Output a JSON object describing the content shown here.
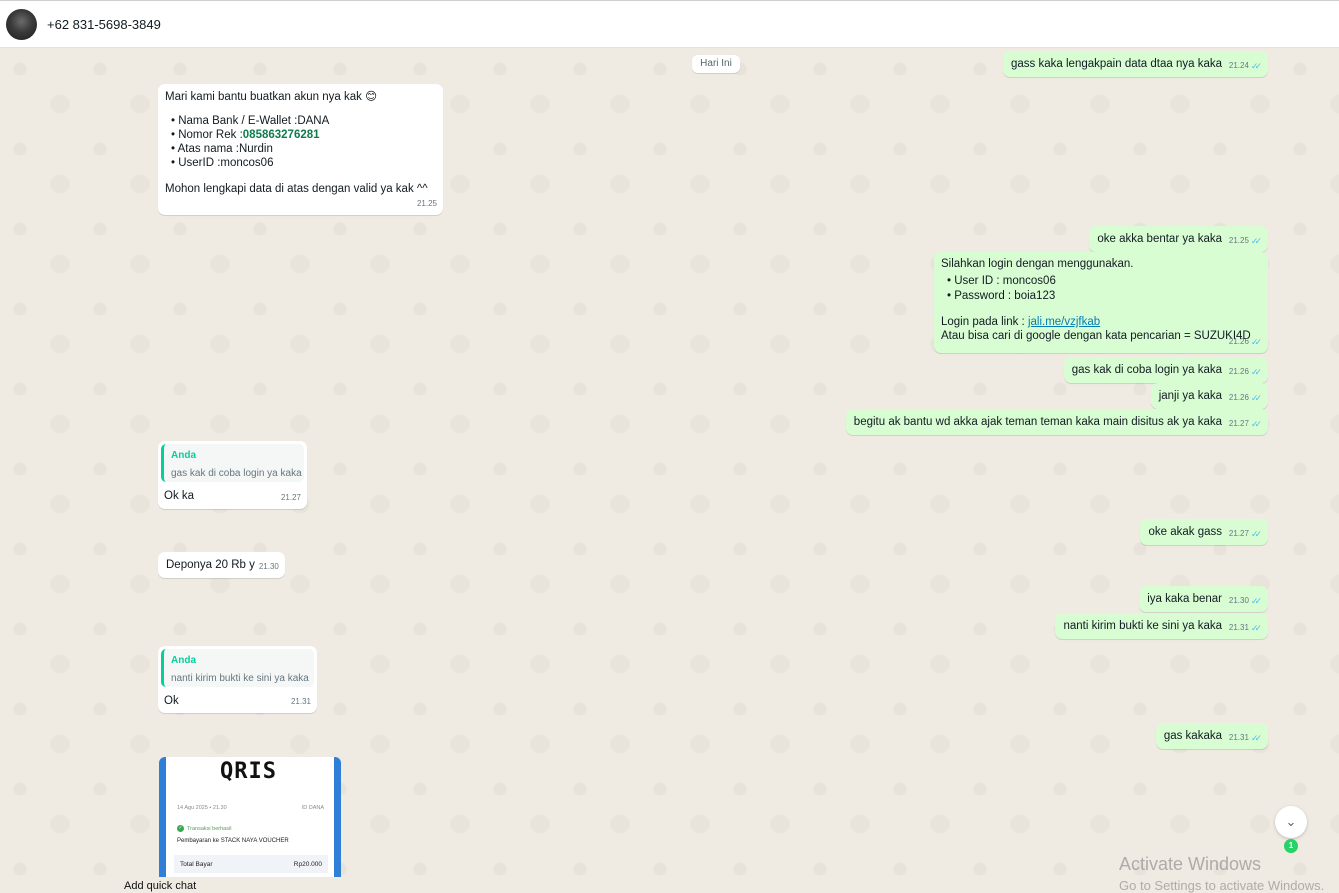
{
  "header": {
    "contact_name": "+62 831-5698-3849"
  },
  "date_divider": "Hari Ini",
  "messages": {
    "m1": {
      "text": "gass kaka lengakpain data dtaa nya kaka",
      "time": "21.24"
    },
    "m2": {
      "intro": "Mari kami bantu buatkan akun nya kak",
      "emoji": "😊",
      "bank_label": "Nama Bank / E-Wallet :",
      "bank_value": "DANA",
      "rek_label": "Nomor Rek :",
      "rek_value": "085863276281",
      "nama_label": "Atas nama :",
      "nama_value": "Nurdin",
      "userid_label": "UserID :",
      "userid_value": "moncos06",
      "closing": "Mohon lengkapi data di atas dengan valid ya kak ^^",
      "time": "21.25"
    },
    "m3": {
      "text": "oke akka bentar ya kaka",
      "time": "21.25"
    },
    "m4": {
      "intro": "Silahkan login dengan menggunakan.",
      "user_line": "User ID : moncos06",
      "pass_line": "Password : boia123",
      "link_label": "Login pada link : ",
      "link_text": "jali.me/vzjfkab",
      "google_line": "Atau bisa cari di google dengan kata pencarian = SUZUKI4D",
      "time": "21.26"
    },
    "m5": {
      "text": "gas kak di coba login ya kaka",
      "time": "21.26"
    },
    "m6": {
      "text": "janji ya kaka",
      "time": "21.26"
    },
    "m7": {
      "text": "begitu ak bantu wd akka ajak teman teman kaka main disitus ak ya kaka",
      "time": "21.27"
    },
    "m8": {
      "quote_author": "Anda",
      "quote_text": "gas kak di coba login ya kaka",
      "text": "Ok ka",
      "time": "21.27"
    },
    "m9": {
      "text": "oke akak gass",
      "time": "21.27"
    },
    "m10": {
      "text": "Deponya 20 Rb y",
      "time": "21.30"
    },
    "m11": {
      "text": "iya kaka benar",
      "time": "21.30"
    },
    "m12": {
      "text": "nanti kirim bukti ke sini ya kaka",
      "time": "21.31"
    },
    "m13": {
      "quote_author": "Anda",
      "quote_text": "nanti kirim bukti ke sini ya kaka",
      "text": "Ok",
      "time": "21.31"
    },
    "m14": {
      "text": "gas kakaka",
      "time": "21.31"
    }
  },
  "receipt": {
    "logo": "QRIS",
    "date": "14 Agu 2025 • 21.30",
    "brand": "ID DANA",
    "status": "Transaksi berhasil",
    "merchant": "Pembayaran ke STACK NAYA VOUCHER",
    "total_label": "Total Bayar",
    "total_value": "Rp20.000"
  },
  "quick_chat_label": "Add quick chat",
  "unread_count": "1",
  "watermark": {
    "line1": "Activate Windows",
    "line2": "Go to Settings to activate Windows."
  },
  "colors": {
    "outgoing_bubble": "#d9fdd3",
    "incoming_bubble": "#ffffff",
    "tick": "#53bdeb",
    "quote_accent": "#06cf9c"
  }
}
